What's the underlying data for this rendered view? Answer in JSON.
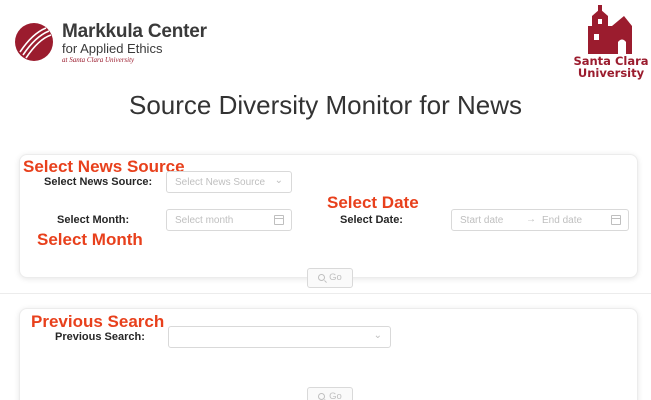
{
  "header": {
    "org_title": "Markkula Center",
    "org_subtitle": "for Applied Ethics",
    "org_affiliation": "at Santa Clara University",
    "university_line1": "Santa Clara",
    "university_line2": "University",
    "page_title": "Source Diversity Monitor for News"
  },
  "colors": {
    "annotation": "#e8401c",
    "brand_red": "#9b1c2e"
  },
  "search_form": {
    "annotations": {
      "news_source": "Select News Source",
      "date": "Select Date",
      "month": "Select Month"
    },
    "news_source": {
      "label": "Select News Source:",
      "placeholder": "Select News Source",
      "icon": "chevron-down-icon"
    },
    "month": {
      "label": "Select Month:",
      "placeholder": "Select month",
      "icon": "calendar-icon"
    },
    "date": {
      "label": "Select Date:",
      "start_placeholder": "Start date",
      "separator": "→",
      "end_placeholder": "End date",
      "icon": "calendar-icon"
    },
    "go_button": {
      "label": "Go",
      "icon": "search-icon"
    }
  },
  "previous_form": {
    "annotation": "Previous Search",
    "previous_search": {
      "label": "Previous Search:",
      "value": "",
      "icon": "chevron-down-icon"
    },
    "go_button": {
      "label": "Go",
      "icon": "search-icon"
    }
  }
}
